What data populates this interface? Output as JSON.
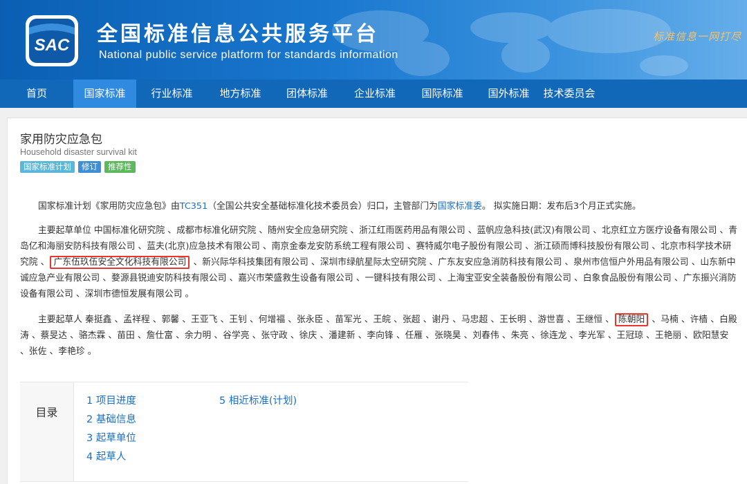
{
  "header": {
    "logo_text": "SAC",
    "title": "全国标准信息公共服务平台",
    "subtitle": "National public service platform  for standards information",
    "slogan": "标准信息一网打尽"
  },
  "nav": {
    "items": [
      "首页",
      "国家标准",
      "行业标准",
      "地方标准",
      "团体标准",
      "企业标准",
      "国际标准",
      "国外标准",
      "技术委员会"
    ],
    "active_index": 1
  },
  "standard": {
    "title": "家用防灾应急包",
    "title_en": "Household disaster survival kit",
    "badges": [
      {
        "label": "国家标准计划",
        "color": "#5bb6d8"
      },
      {
        "label": "修订",
        "color": "#3f8fd4"
      },
      {
        "label": "推荐性",
        "color": "#5cb85c"
      }
    ]
  },
  "plan": {
    "text_a": "国家标准计划《家用防灾应急包》由",
    "tc_link": "TC351",
    "text_b": "（全国公共安全基础标准化技术委员会）归口，主管部门为",
    "dept_link": "国家标准委",
    "text_c": "。  拟实施日期：发布后3个月正式实施。"
  },
  "drafting_units": {
    "before": "主要起草单位 中国标准化研究院 、成都市标准化研究院 、随州安全应急研究院 、浙江红雨医药用品有限公司 、蓝帆应急科技(武汉)有限公司 、北京红立方医疗设备有限公司 、青岛亿和海丽安防科技有限公司 、蓝夫(北京)应急技术有限公司 、南京金泰龙安防系统工程有限公司 、赛特威尔电子股份有限公司 、浙江硕而博科技股份有限公司 、北京市科学技术研究院 、",
    "highlight": "广东伍玖伍安全文化科技有限公司",
    "after": " 、新兴际华科技集团有限公司 、深圳市绿航星际太空研究院 、广东友安应急消防科技有限公司 、泉州市信恒户外用品有限公司 、山东新中诚应急产业有限公司 、婺源县锐迪安防科技有限公司 、嘉兴市荣盛救生设备有限公司 、一键科技有限公司 、上海宝亚安全装备股份有限公司 、白象食品股份有限公司 、广东振兴消防设备有限公司 、深圳市德恒发展有限公司 。"
  },
  "drafters": {
    "before": "主要起草人 秦挺鑫 、孟祥程 、郭馨 、王亚飞 、王钊 、何增福 、张永臣 、苗军光 、王皖 、张超 、谢丹 、马忠超 、王长明 、游世喜 、王继恒 、",
    "highlight": "陈朝阳",
    "after": " 、马楠 、许樯 、白殿涛 、蔡旻达 、骆杰霖 、苗田 、詹仕富 、余力明 、谷学亮 、张守政 、徐庆 、潘建新 、李向锋 、任雁 、张晓昊 、刘春伟 、朱亮 、徐连龙 、李光军 、王冠琼 、王艳丽 、欧阳慧安 、张佐 、李艳珍 。"
  },
  "toc": {
    "label": "目录",
    "col1": [
      "1 项目进度",
      "2 基础信息",
      "3 起草单位",
      "4 起草人"
    ],
    "col2": [
      "5 相近标准(计划)"
    ]
  },
  "colors": {
    "nav_bg": "#1167b8",
    "nav_active": "#2f8ae0",
    "link": "#1a6fc4",
    "highlight_border": "#e8362e"
  }
}
